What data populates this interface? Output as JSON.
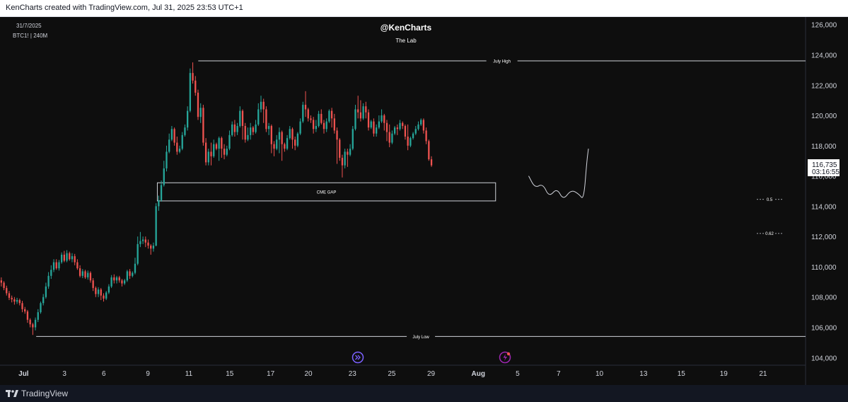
{
  "header": {
    "attribution": "KenCharts created with TradingView.com, Jul 31, 2025 23:53 UTC+1"
  },
  "overlay": {
    "date_label": "31/7/2025",
    "symbol_label": "BTC1! | 240M",
    "author": "@KenCharts",
    "subtitle": "The Lab"
  },
  "footer": {
    "brand": "TradingView",
    "replay_icon": "replay-icon",
    "event_icon": "lightning-icon"
  },
  "colors": {
    "background": "#0e0e0e",
    "up": "#26a69a",
    "down": "#ef5350",
    "text": "#d1d4dc",
    "price_tag_bg": "#ffffff"
  },
  "chart_data": {
    "type": "candlestick",
    "yaxis": {
      "range": [
        103500,
        126500
      ],
      "ticks": [
        "126,000",
        "124,000",
        "122,000",
        "120,000",
        "118,000",
        "116,000",
        "114,000",
        "112,000",
        "110,000",
        "108,000",
        "106,000",
        "104,000"
      ],
      "tick_values": [
        126000,
        124000,
        122000,
        120000,
        118000,
        116000,
        114000,
        112000,
        110000,
        108000,
        106000,
        104000
      ]
    },
    "xaxis": {
      "range": [
        0,
        51.2
      ],
      "tick_labels": [
        "Jul",
        "3",
        "6",
        "9",
        "11",
        "15",
        "17",
        "20",
        "23",
        "25",
        "29",
        "Aug",
        "5",
        "7",
        "10",
        "13",
        "15",
        "19",
        "21"
      ],
      "tick_days": [
        1.5,
        4.1,
        6.6,
        9.4,
        12.0,
        14.6,
        17.2,
        19.6,
        22.4,
        24.9,
        27.4,
        30.4,
        32.9,
        35.5,
        38.1,
        40.9,
        43.3,
        46.0,
        48.5
      ]
    },
    "price": {
      "last": "116,735",
      "countdown": "03:16:55"
    },
    "levels": [
      {
        "label": "July High",
        "price": 123600,
        "from_day": 12.6
      },
      {
        "label": "July Low",
        "price": 105400,
        "from_day": 2.3
      }
    ],
    "zones": [
      {
        "label": "CME GAP",
        "price_top": 115550,
        "price_bottom": 114350,
        "from_day": 10.0,
        "to_day": 31.5
      }
    ],
    "fib_levels": [
      {
        "label": "0.5",
        "price": 114450
      },
      {
        "label": "0.62",
        "price": 112200
      }
    ],
    "projection": [
      [
        33.6,
        116000
      ],
      [
        34.0,
        115200
      ],
      [
        34.5,
        115500
      ],
      [
        34.9,
        114600
      ],
      [
        35.4,
        115200
      ],
      [
        35.8,
        114400
      ],
      [
        36.3,
        115100
      ],
      [
        36.8,
        114800
      ],
      [
        37.1,
        114400
      ],
      [
        37.3,
        117000
      ],
      [
        37.4,
        117800
      ]
    ],
    "candle_step_days": 0.1667,
    "candles": [
      [
        109100,
        108950,
        108700,
        109300
      ],
      [
        108950,
        108600,
        108450,
        109050
      ],
      [
        108600,
        108250,
        108100,
        108750
      ],
      [
        108250,
        107950,
        107800,
        108400
      ],
      [
        107950,
        107850,
        107650,
        108100
      ],
      [
        107850,
        107700,
        107500,
        108000
      ],
      [
        107700,
        107800,
        107550,
        107950
      ],
      [
        107800,
        107600,
        107450,
        107900
      ],
      [
        107600,
        107200,
        107000,
        107750
      ],
      [
        107200,
        107050,
        106900,
        107350
      ],
      [
        107050,
        106500,
        106300,
        107150
      ],
      [
        106500,
        106200,
        106000,
        106600
      ],
      [
        106200,
        106000,
        105500,
        106300
      ],
      [
        106000,
        106500,
        105800,
        106650
      ],
      [
        106500,
        107000,
        106350,
        107200
      ],
      [
        107000,
        107600,
        106900,
        107700
      ],
      [
        107600,
        108000,
        107450,
        108200
      ],
      [
        108000,
        108700,
        107900,
        108950
      ],
      [
        108700,
        109400,
        108550,
        109650
      ],
      [
        109400,
        109800,
        109200,
        110100
      ],
      [
        109800,
        110300,
        109650,
        110500
      ],
      [
        110300,
        109900,
        109800,
        110500
      ],
      [
        109900,
        110300,
        109750,
        110450
      ],
      [
        110300,
        110800,
        110200,
        110950
      ],
      [
        110800,
        110400,
        110300,
        111050
      ],
      [
        110400,
        110900,
        110300,
        111100
      ],
      [
        110900,
        110500,
        110400,
        111000
      ],
      [
        110500,
        110700,
        110300,
        110900
      ],
      [
        110700,
        110300,
        110100,
        110850
      ],
      [
        110300,
        109900,
        109800,
        110500
      ],
      [
        109900,
        109400,
        109300,
        110100
      ],
      [
        109400,
        109700,
        109250,
        109850
      ],
      [
        109700,
        109300,
        109200,
        109800
      ],
      [
        109300,
        109600,
        109150,
        109750
      ],
      [
        109600,
        109100,
        108950,
        109700
      ],
      [
        109100,
        108600,
        108400,
        109250
      ],
      [
        108600,
        108200,
        108000,
        108700
      ],
      [
        108200,
        108500,
        108000,
        108650
      ],
      [
        108500,
        108100,
        107800,
        108600
      ],
      [
        108100,
        107900,
        107700,
        108250
      ],
      [
        107900,
        108300,
        107800,
        108400
      ],
      [
        108300,
        108700,
        108200,
        108850
      ],
      [
        108700,
        109300,
        108600,
        109450
      ],
      [
        109300,
        109100,
        108900,
        109500
      ],
      [
        109100,
        109300,
        108900,
        109400
      ],
      [
        109300,
        109100,
        108950,
        109400
      ],
      [
        109100,
        108900,
        108700,
        109200
      ],
      [
        108900,
        109100,
        108800,
        109200
      ],
      [
        109100,
        109700,
        109000,
        109800
      ],
      [
        109700,
        109400,
        109200,
        109850
      ],
      [
        109400,
        109600,
        109300,
        109700
      ],
      [
        109600,
        110200,
        109500,
        110600
      ],
      [
        110200,
        111500,
        110100,
        112000
      ],
      [
        111500,
        111700,
        111300,
        112300
      ],
      [
        111700,
        111800,
        111500,
        112000
      ],
      [
        111800,
        111600,
        111300,
        112000
      ],
      [
        111600,
        111400,
        111200,
        111800
      ],
      [
        111400,
        111200,
        110800,
        111500
      ],
      [
        111200,
        111400,
        111000,
        111600
      ],
      [
        111400,
        114000,
        111350,
        114200
      ],
      [
        114000,
        114400,
        113700,
        114700
      ],
      [
        114400,
        115400,
        114300,
        115700
      ],
      [
        115400,
        116500,
        115300,
        117000
      ],
      [
        116500,
        117600,
        116300,
        118000
      ],
      [
        117600,
        118400,
        117500,
        118800
      ],
      [
        118400,
        119100,
        118300,
        119300
      ],
      [
        119100,
        118200,
        118000,
        119200
      ],
      [
        118200,
        117600,
        117400,
        118600
      ],
      [
        117600,
        117800,
        117500,
        118000
      ],
      [
        117800,
        118700,
        117700,
        118900
      ],
      [
        118700,
        119200,
        118600,
        119400
      ],
      [
        119200,
        120300,
        119000,
        120600
      ],
      [
        120300,
        122800,
        120200,
        123100
      ],
      [
        122800,
        122300,
        122100,
        123500
      ],
      [
        122300,
        121500,
        121300,
        122600
      ],
      [
        121500,
        119900,
        119700,
        121700
      ],
      [
        119900,
        120500,
        119500,
        120800
      ],
      [
        120500,
        118200,
        118000,
        120700
      ],
      [
        118200,
        116900,
        116700,
        118500
      ],
      [
        116900,
        117600,
        116700,
        117800
      ],
      [
        117600,
        117300,
        116700,
        118200
      ],
      [
        117300,
        118100,
        117200,
        118400
      ],
      [
        118100,
        117800,
        117700,
        118200
      ],
      [
        117800,
        118500,
        117000,
        118600
      ],
      [
        118500,
        117800,
        117200,
        118600
      ],
      [
        117800,
        117400,
        117100,
        118100
      ],
      [
        117400,
        117800,
        117300,
        118000
      ],
      [
        117800,
        118700,
        117700,
        119000
      ],
      [
        118700,
        119400,
        118600,
        119600
      ],
      [
        119400,
        118900,
        118600,
        119700
      ],
      [
        118900,
        119300,
        118700,
        119500
      ],
      [
        119300,
        120300,
        119200,
        120600
      ],
      [
        120300,
        119300,
        118400,
        120400
      ],
      [
        119300,
        118400,
        118200,
        119500
      ],
      [
        118400,
        118700,
        118300,
        119200
      ],
      [
        118700,
        119200,
        118400,
        119500
      ],
      [
        119200,
        118900,
        118700,
        119300
      ],
      [
        118900,
        119400,
        118800,
        119700
      ],
      [
        119400,
        120400,
        119300,
        120800
      ],
      [
        120400,
        120900,
        120200,
        121300
      ],
      [
        120900,
        120400,
        119500,
        121100
      ],
      [
        120400,
        119100,
        118900,
        120600
      ],
      [
        119100,
        119300,
        118700,
        119500
      ],
      [
        119300,
        118100,
        117500,
        119400
      ],
      [
        118100,
        117800,
        117300,
        118300
      ],
      [
        117800,
        118400,
        117700,
        118700
      ],
      [
        118400,
        118900,
        117500,
        119200
      ],
      [
        118900,
        118100,
        117000,
        119000
      ],
      [
        118100,
        117800,
        117600,
        118200
      ],
      [
        117800,
        118500,
        117700,
        118700
      ],
      [
        118500,
        119100,
        118400,
        119300
      ],
      [
        119100,
        118400,
        117800,
        119200
      ],
      [
        118400,
        118000,
        117700,
        118600
      ],
      [
        118000,
        118800,
        117900,
        118900
      ],
      [
        118800,
        119600,
        118700,
        119800
      ],
      [
        119600,
        120700,
        119500,
        120900
      ],
      [
        120700,
        120400,
        119900,
        121600
      ],
      [
        120400,
        119800,
        119600,
        120500
      ],
      [
        119800,
        119700,
        119500,
        120000
      ],
      [
        119700,
        119100,
        118800,
        119900
      ],
      [
        119100,
        119300,
        118900,
        119700
      ],
      [
        119300,
        120100,
        119200,
        120300
      ],
      [
        120100,
        119500,
        119400,
        120400
      ],
      [
        119500,
        119100,
        118800,
        119700
      ],
      [
        119100,
        119600,
        118900,
        119800
      ],
      [
        119600,
        120300,
        119500,
        120400
      ],
      [
        120300,
        119800,
        119200,
        120500
      ],
      [
        119800,
        119000,
        118800,
        120100
      ],
      [
        119000,
        118400,
        116800,
        119200
      ],
      [
        118400,
        117200,
        117000,
        118500
      ],
      [
        117200,
        116700,
        115900,
        117400
      ],
      [
        116700,
        117600,
        116500,
        117800
      ],
      [
        117600,
        117400,
        116600,
        117800
      ],
      [
        117400,
        117800,
        117300,
        118100
      ],
      [
        117800,
        119100,
        117700,
        119300
      ],
      [
        119100,
        120400,
        119000,
        120700
      ],
      [
        120400,
        120200,
        119800,
        121300
      ],
      [
        120200,
        119800,
        119600,
        121000
      ],
      [
        119800,
        120600,
        119700,
        120800
      ],
      [
        120600,
        120200,
        119800,
        120900
      ],
      [
        120200,
        119200,
        119000,
        120400
      ],
      [
        119200,
        119600,
        119100,
        119700
      ],
      [
        119600,
        118800,
        118600,
        119800
      ],
      [
        118800,
        119200,
        118600,
        119400
      ],
      [
        119200,
        119600,
        119100,
        120000
      ],
      [
        119600,
        120000,
        119500,
        120400
      ],
      [
        120000,
        119500,
        119000,
        120100
      ],
      [
        119500,
        118900,
        118300,
        119700
      ],
      [
        118900,
        118200,
        117900,
        119400
      ],
      [
        118200,
        118800,
        118100,
        119000
      ],
      [
        118800,
        119200,
        118700,
        119300
      ],
      [
        119200,
        119100,
        118700,
        119400
      ],
      [
        119100,
        119500,
        119000,
        119700
      ],
      [
        119500,
        119300,
        119100,
        119600
      ],
      [
        119300,
        118600,
        118400,
        119400
      ],
      [
        118600,
        118000,
        117700,
        119400
      ],
      [
        118000,
        118500,
        117900,
        118600
      ],
      [
        118500,
        118800,
        118400,
        118900
      ],
      [
        118800,
        119100,
        118700,
        119300
      ],
      [
        119100,
        119400,
        119000,
        119600
      ],
      [
        119400,
        119700,
        119300,
        119800
      ],
      [
        119700,
        119000,
        118800,
        119800
      ],
      [
        119000,
        118300,
        118100,
        119200
      ],
      [
        118300,
        117100,
        117000,
        118400
      ],
      [
        117100,
        116700,
        116600,
        117300
      ]
    ]
  }
}
